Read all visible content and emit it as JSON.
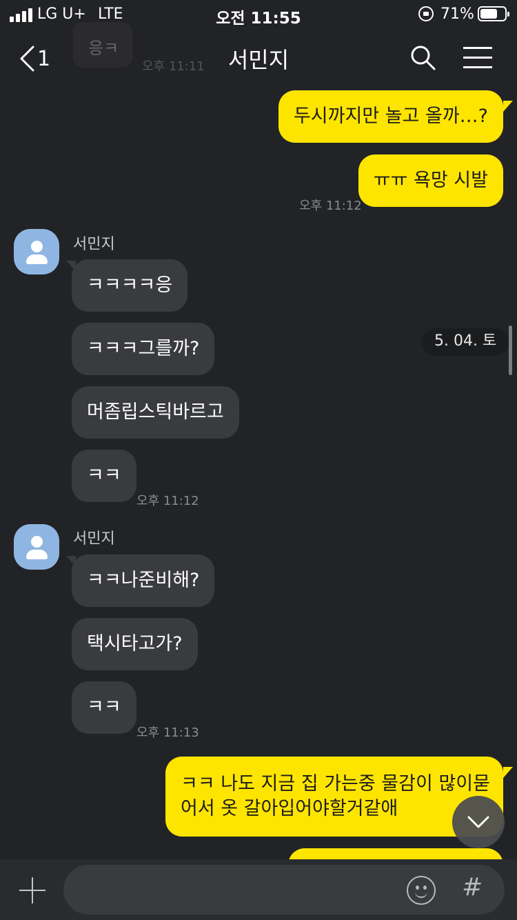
{
  "status_bar": {
    "carrier": "LG U+",
    "network": "LTE",
    "time": "오전 11:55",
    "battery": "71%",
    "battery_level": 0.71
  },
  "header": {
    "back_count": "1",
    "title": "서민지",
    "ghost_message": "응ㅋ",
    "ghost_time": "오후 11:11"
  },
  "chat": {
    "outgoing_1": [
      "두시까지만 놀고 올까…?",
      "ㅠㅠ 욕망 시발"
    ],
    "outgoing_1_time": "오후 11:12",
    "group_1": {
      "sender": "서민지",
      "messages": [
        "ㅋㅋㅋㅋ응",
        "ㅋㅋㅋ그를까?",
        "머좀립스틱바르고",
        "ㅋㅋ"
      ],
      "time": "오후 11:12"
    },
    "group_2": {
      "sender": "서민지",
      "messages": [
        "ㅋㅋ나준비해?",
        "택시타고가?",
        "ㅋㅋ"
      ],
      "time": "오후 11:13"
    },
    "outgoing_2": [
      "ㅋㅋ 나도 지금 집 가는중 물감이 많이묻",
      "어서 옷 갈아입어야할거같애"
    ]
  },
  "date_badge": "5. 04. 토",
  "input": {
    "placeholder": "",
    "hash_label": "#"
  },
  "colors": {
    "background": "#222326",
    "my_bubble": "#fee500",
    "their_bubble": "#3a3b3e",
    "avatar": "#8fb6e3"
  },
  "icons": [
    "back-chevron-icon",
    "search-icon",
    "menu-icon",
    "person-icon",
    "chevron-down-icon",
    "plus-icon",
    "emoji-icon",
    "hash-icon",
    "lock-rotation-icon",
    "battery-icon",
    "signal-icon"
  ]
}
